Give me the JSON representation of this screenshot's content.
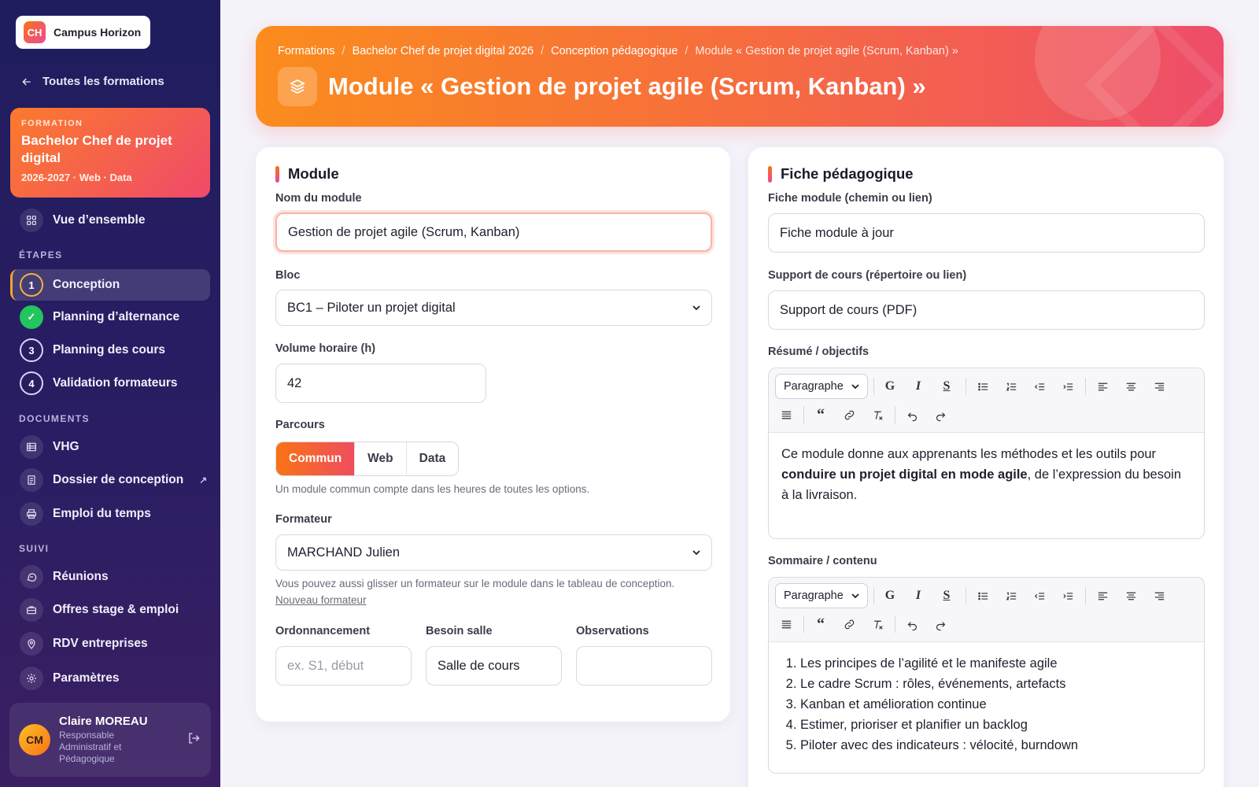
{
  "sidebar": {
    "logo_badge": "CH",
    "logo_name": "Campus Horizon",
    "back_label": "Toutes les formations",
    "formation": {
      "eyebrow": "FORMATION",
      "title": "Bachelor Chef de projet digital",
      "meta": "2026-2027 · Web · Data"
    },
    "overview_label": "Vue d’ensemble",
    "steps_heading": "ÉTAPES",
    "steps": [
      {
        "number": "1",
        "label": "Conception",
        "state": "current"
      },
      {
        "number": "✓",
        "label": "Planning d’alternance",
        "state": "done"
      },
      {
        "number": "3",
        "label": "Planning des cours",
        "state": "todo"
      },
      {
        "number": "4",
        "label": "Validation formateurs",
        "state": "todo"
      }
    ],
    "documents_heading": "DOCUMENTS",
    "documents": [
      {
        "label": "VHG",
        "icon": "table-icon"
      },
      {
        "label": "Dossier de conception",
        "icon": "document-icon",
        "external": "↗"
      },
      {
        "label": "Emploi du temps",
        "icon": "printer-icon"
      }
    ],
    "suivi_heading": "SUIVI",
    "suivi": [
      {
        "label": "Réunions",
        "icon": "chat-icon"
      },
      {
        "label": "Offres stage & emploi",
        "icon": "briefcase-icon"
      },
      {
        "label": "RDV entreprises",
        "icon": "location-pin-icon"
      },
      {
        "label": "Paramètres",
        "icon": "gear-icon"
      }
    ],
    "user": {
      "initials": "CM",
      "name": "Claire MOREAU",
      "role": "Responsable Administratif et Pédagogique"
    }
  },
  "header": {
    "breadcrumb": [
      "Formations",
      "Bachelor Chef de projet digital 2026",
      "Conception pédagogique",
      "Module « Gestion de projet agile (Scrum, Kanban) »"
    ],
    "title": "Module « Gestion de projet agile (Scrum, Kanban) »"
  },
  "module_card": {
    "title": "Module",
    "name_label": "Nom du module",
    "name_value": "Gestion de projet agile (Scrum, Kanban)",
    "bloc_label": "Bloc",
    "bloc_value": "BC1 – Piloter un projet digital",
    "volume_label": "Volume horaire (h)",
    "volume_value": "42",
    "parcours_label": "Parcours",
    "parcours_options": [
      "Commun",
      "Web",
      "Data"
    ],
    "parcours_selected": "Commun",
    "parcours_help": "Un module commun compte dans les heures de toutes les options.",
    "formateur_label": "Formateur",
    "formateur_value": "MARCHAND Julien",
    "formateur_help": "Vous pouvez aussi glisser un formateur sur le module dans le tableau de conception.",
    "nouveau_formateur_link": "Nouveau formateur",
    "ordonnancement_label": "Ordonnancement",
    "ordonnancement_placeholder": "ex. S1, début",
    "besoin_salle_label": "Besoin salle",
    "besoin_salle_value": "Salle de cours",
    "observations_label": "Observations",
    "observations_value": ""
  },
  "fiche_card": {
    "title": "Fiche pédagogique",
    "fiche_label": "Fiche module (chemin ou lien)",
    "fiche_value": "Fiche module à jour",
    "support_label": "Support de cours (répertoire ou lien)",
    "support_value": "Support de cours (PDF)",
    "resume_label": "Résumé / objectifs",
    "resume_text_before": "Ce module donne aux apprenants les méthodes et les outils pour ",
    "resume_text_bold": "conduire un projet digital en mode agile",
    "resume_text_after": ", de l’expression du besoin à la livraison.",
    "sommaire_label": "Sommaire / contenu",
    "sommaire_items": [
      "Les principes de l’agilité et le manifeste agile",
      "Le cadre Scrum : rôles, événements, artefacts",
      "Kanban et amélioration continue",
      "Estimer, prioriser et planifier un backlog",
      "Piloter avec des indicateurs : vélocité, burndown"
    ],
    "editor_toolbar": {
      "block_format": "Paragraphe",
      "bold": "G",
      "italic": "I",
      "strike": "S",
      "quote": "“"
    }
  }
}
